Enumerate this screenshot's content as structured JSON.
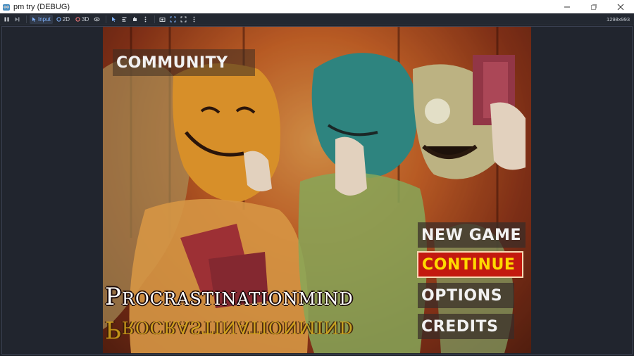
{
  "window": {
    "title": "pm try (DEBUG)",
    "icon": "godot-icon"
  },
  "toolbar": {
    "modes": [
      {
        "label": "Input",
        "icon": "input-icon",
        "active": true
      },
      {
        "label": "2D",
        "icon": "circle-2d-icon",
        "active": false
      },
      {
        "label": "3D",
        "icon": "circle-3d-icon",
        "active": false
      }
    ],
    "resolution": "1298x993"
  },
  "game": {
    "community_label": "COMMUNITY",
    "menu": {
      "new_game": "NEW GAME",
      "continue": "CONTINUE",
      "options": "OPTIONS",
      "credits": "CREDITS"
    },
    "logo_text": "Procrastinationmind",
    "colors": {
      "continue_bg": "#c3190f",
      "continue_text": "#ffd900",
      "button_text": "#f2f2f2"
    }
  }
}
